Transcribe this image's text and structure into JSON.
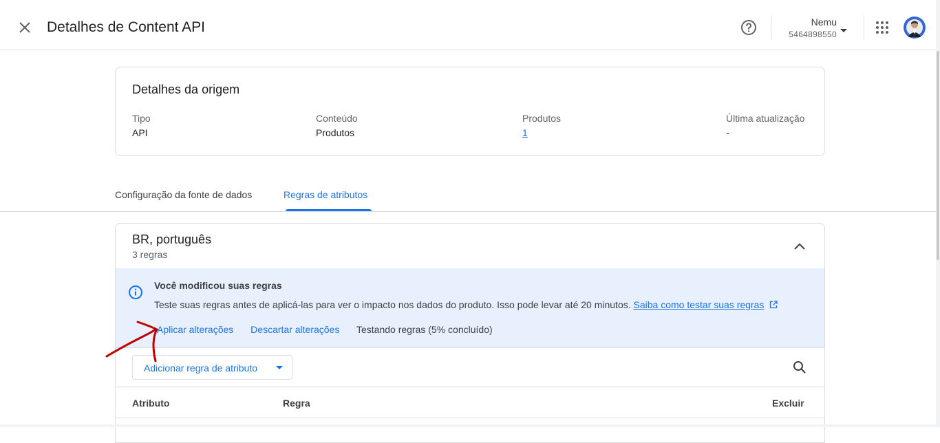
{
  "header": {
    "title": "Detalhes de Content API",
    "account_name": "Nemu",
    "account_id": "5464898550"
  },
  "source_card": {
    "title": "Detalhes da origem",
    "fields": [
      {
        "label": "Tipo",
        "value": "API"
      },
      {
        "label": "Conteúdo",
        "value": "Produtos"
      },
      {
        "label": "Produtos",
        "value": "1"
      },
      {
        "label": "Última atualização",
        "value": "-"
      }
    ]
  },
  "tabs": [
    {
      "label": "Configuração da fonte de dados",
      "active": false
    },
    {
      "label": "Regras de atributos",
      "active": true
    }
  ],
  "rules_panel": {
    "title": "BR, português",
    "subtitle": "3 regras",
    "notice": {
      "title": "Você modificou suas regras",
      "text": "Teste suas regras antes de aplicá-las para ver o impacto nos dados do produto. Isso pode levar até 20 minutos.",
      "link": "Saiba como testar suas regras",
      "apply_label": "Aplicar alterações",
      "discard_label": "Descartar alterações",
      "status": "Testando regras (5% concluído)",
      "progress_percent": 5
    },
    "add_rule_label": "Adicionar regra de atributo",
    "columns": [
      "Atributo",
      "Regra",
      "Excluir"
    ]
  },
  "colors": {
    "accent": "#1a73e8",
    "notice_bg": "#e8f0fe",
    "annotation": "#c00000"
  },
  "icons": [
    "close-icon",
    "help-icon",
    "chevron-down-icon",
    "apps-grid-icon",
    "avatar",
    "chevron-up-icon",
    "info-icon",
    "external-link-icon",
    "search-icon"
  ]
}
